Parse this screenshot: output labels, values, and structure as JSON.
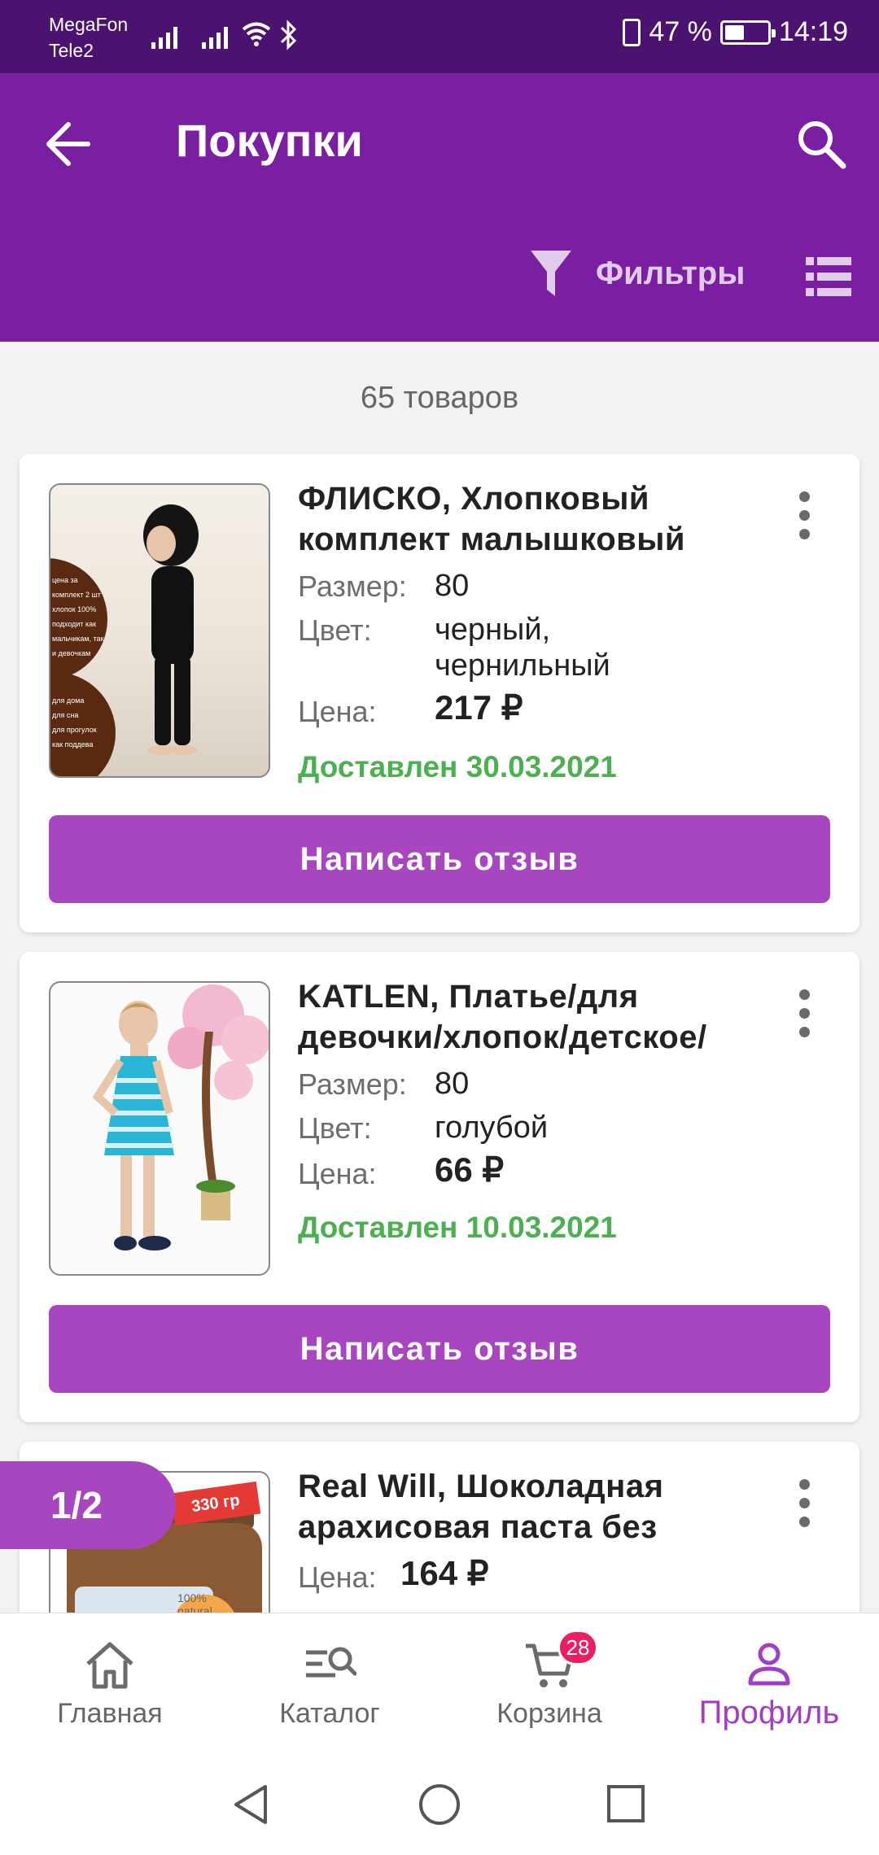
{
  "status_bar": {
    "carrier_1": "MegaFon",
    "carrier_2": "Tele2",
    "battery_percent": "47 %",
    "battery_level": 0.47,
    "time": "14:19"
  },
  "app_bar": {
    "title": "Покупки",
    "filter_label": "Фильтры"
  },
  "items_count": "65 товаров",
  "labels": {
    "size": "Размер:",
    "color": "Цвет:",
    "price": "Цена:",
    "review_button": "Написать отзыв"
  },
  "purchases": [
    {
      "name_line1": "ФЛИСКО, Хлопковый",
      "name_line2": "комплект малышковый",
      "size": "80",
      "color_line1": "черный,",
      "color_line2": "чернильный",
      "price": "217 ₽",
      "status": "Доставлен 30.03.2021",
      "image_text": [
        "цена за",
        "комплект 2 шт",
        "хлопок 100%",
        "подходит как",
        "мальчикам, так",
        "и девочкам",
        "",
        "для дома",
        "для сна",
        "для прогулок",
        "как поддева"
      ]
    },
    {
      "name_line1": "KATLEN, Платье/для",
      "name_line2": "девочки/хлопок/детское/",
      "size": "80",
      "color_line1": "голубой",
      "price": "66 ₽",
      "status": "Доставлен 10.03.2021"
    },
    {
      "name_line1": "Real Will, Шоколадная",
      "name_line2": "арахисовая паста без",
      "price": "164 ₽",
      "image_tag": "330 гр",
      "image_label": "100% natural"
    }
  ],
  "pager": "1/2",
  "bottom_nav": [
    {
      "label": "Главная",
      "icon": "home-icon"
    },
    {
      "label": "Каталог",
      "icon": "catalog-search-icon"
    },
    {
      "label": "Корзина",
      "icon": "cart-icon",
      "badge": "28"
    },
    {
      "label": "Профиль",
      "icon": "profile-icon",
      "active": true
    }
  ],
  "colors": {
    "status_bar": "#4b136f",
    "app_bar": "#7b1fa2",
    "accent": "#a846c0",
    "delivered": "#4caf50",
    "badge": "#e91e63"
  }
}
